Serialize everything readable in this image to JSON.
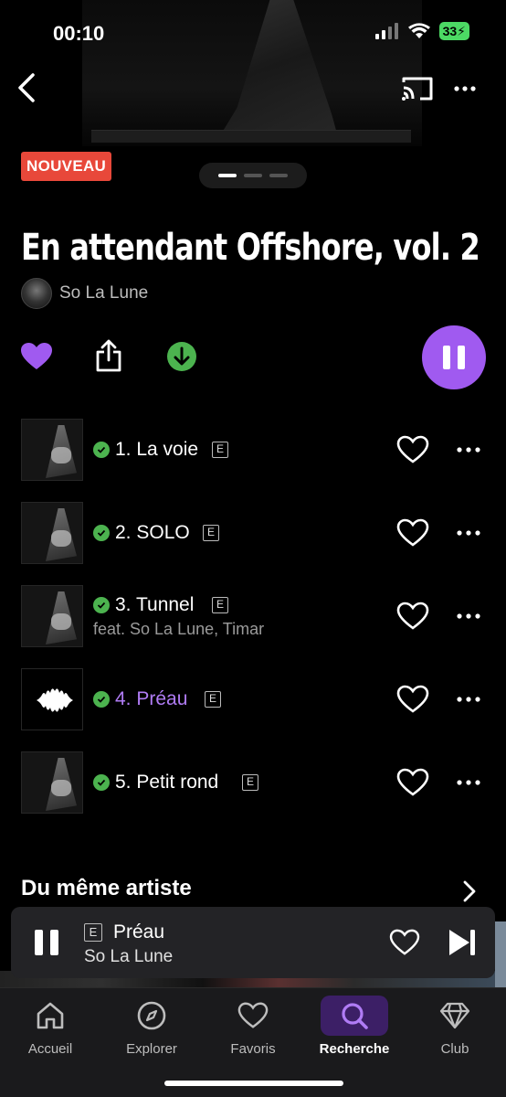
{
  "status_bar": {
    "time": "00:10",
    "battery": "33"
  },
  "badge": "NOUVEAU",
  "album": {
    "title": "En attendant Offshore, vol. 2",
    "artist": "So La Lune"
  },
  "colors": {
    "accent": "#a05af0",
    "badge": "#e8483a",
    "downloaded": "#4cb34f",
    "now_playing_text": "#b07cf5"
  },
  "tracks": [
    {
      "title": "1. La voie",
      "explicit": "E",
      "subtitle": "",
      "playing": false
    },
    {
      "title": "2. SOLO",
      "explicit": "E",
      "subtitle": "",
      "playing": false
    },
    {
      "title": "3. Tunnel",
      "explicit": "E",
      "subtitle": "feat. So La Lune, Timar",
      "playing": false
    },
    {
      "title": "4. Préau",
      "explicit": "E",
      "subtitle": "",
      "playing": true
    },
    {
      "title": "5. Petit rond",
      "explicit": "E",
      "subtitle": "",
      "playing": false
    }
  ],
  "section": {
    "title": "Du même artiste"
  },
  "mini_player": {
    "explicit": "E",
    "title": "Préau",
    "artist": "So La Lune"
  },
  "tabs": [
    {
      "label": "Accueil",
      "icon": "home-icon"
    },
    {
      "label": "Explorer",
      "icon": "compass-icon"
    },
    {
      "label": "Favoris",
      "icon": "heart-icon"
    },
    {
      "label": "Recherche",
      "icon": "search-icon",
      "active": true
    },
    {
      "label": "Club",
      "icon": "diamond-icon"
    }
  ]
}
